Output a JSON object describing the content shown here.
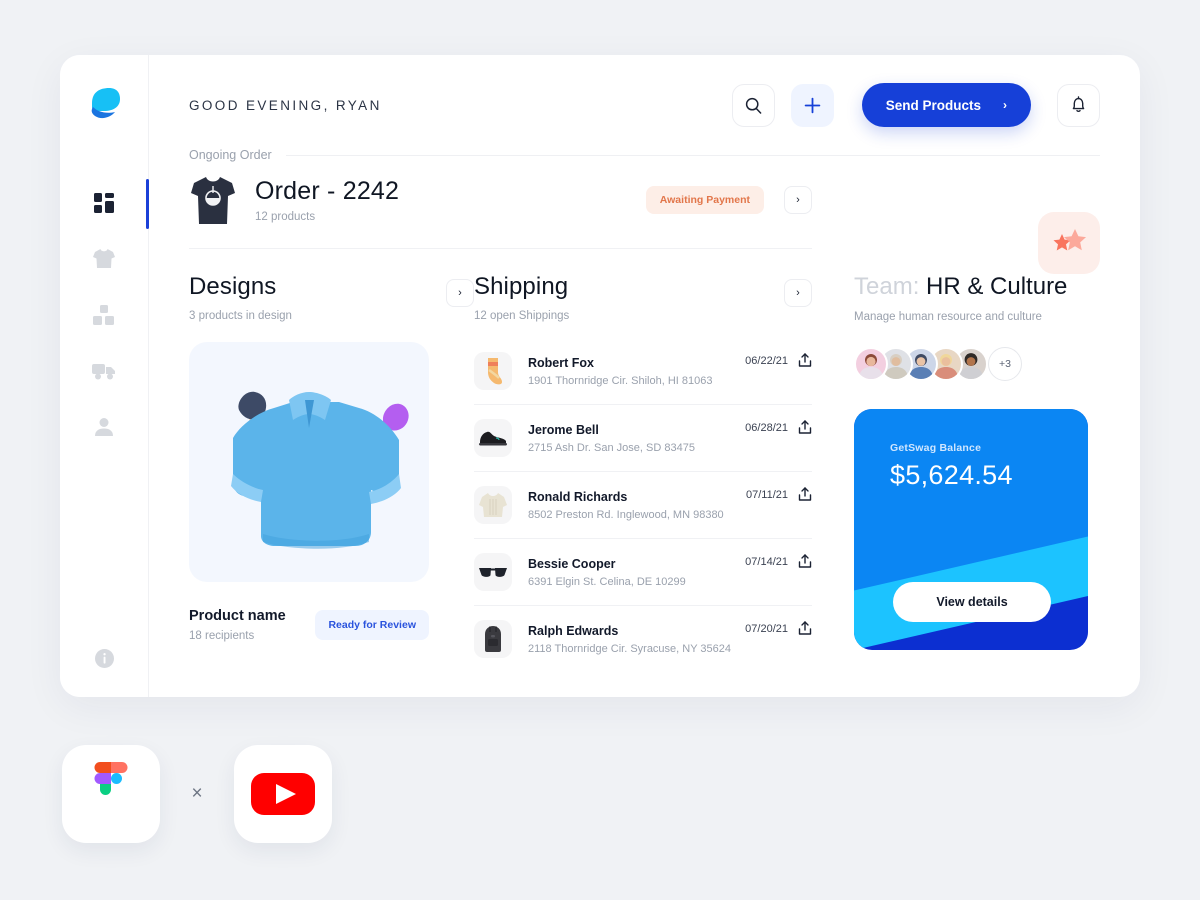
{
  "brand": {
    "logo_icon": "chat-bubble-logo"
  },
  "sidebar": {
    "items": [
      {
        "name": "dashboard",
        "icon": "grid-dashboard-icon",
        "active": true
      },
      {
        "name": "apparel",
        "icon": "tshirt-icon",
        "active": false
      },
      {
        "name": "products",
        "icon": "boxes-icon",
        "active": false
      },
      {
        "name": "shipping",
        "icon": "truck-icon",
        "active": false
      },
      {
        "name": "account",
        "icon": "person-icon",
        "active": false
      }
    ],
    "footer": {
      "icon": "info-circle-icon"
    }
  },
  "header": {
    "greeting": "GOOD EVENING, RYAN",
    "search_icon": "search-icon",
    "add_icon": "plus-icon",
    "send_products_label": "Send Products",
    "send_products_chevron": "›",
    "bell_icon": "bell-icon"
  },
  "ongoing": {
    "section_label": "Ongoing Order",
    "thumb_icon": "black-tshirt-thumbnail",
    "title": "Order - 2242",
    "subtitle": "12 products",
    "status_badge": "Awaiting Payment",
    "chevron": "›",
    "star_tile_icon": "stars-icon"
  },
  "designs": {
    "title": "Designs",
    "subtitle": "3 products in design",
    "chevron": "›",
    "image_icon": "blue-polo-shirt-3d-illustration",
    "product_name": "Product name",
    "product_sub": "18 recipients",
    "status_badge": "Ready for Review"
  },
  "shipping": {
    "title": "Shipping",
    "subtitle": "12 open Shippings",
    "chevron": "›",
    "rows": [
      {
        "thumb": "sock-thumbnail",
        "name": "Robert Fox",
        "address": "1901 Thornridge Cir. Shiloh, HI 81063",
        "date": "06/22/21",
        "action_icon": "share-upload-icon"
      },
      {
        "thumb": "sneaker-thumbnail",
        "name": "Jerome Bell",
        "address": "2715 Ash Dr. San Jose, SD 83475",
        "date": "06/28/21",
        "action_icon": "share-upload-icon"
      },
      {
        "thumb": "sweater-thumbnail",
        "name": "Ronald Richards",
        "address": "8502 Preston Rd. Inglewood, MN 98380",
        "date": "07/11/21",
        "action_icon": "share-upload-icon"
      },
      {
        "thumb": "sunglasses-thumbnail",
        "name": "Bessie Cooper",
        "address": "6391 Elgin St. Celina, DE 10299",
        "date": "07/14/21",
        "action_icon": "share-upload-icon"
      },
      {
        "thumb": "backpack-thumbnail",
        "name": "Ralph Edwards",
        "address": "2118 Thornridge Cir. Syracuse, NY 35624",
        "date": "07/20/21",
        "action_icon": "share-upload-icon"
      }
    ]
  },
  "team": {
    "title_prefix": "Team:",
    "title_name": "HR & Culture",
    "subtitle": "Manage human resource and culture",
    "avatars": [
      {
        "name": "member-1",
        "color": "#f3cfe0"
      },
      {
        "name": "member-2",
        "color": "#dfe1e6"
      },
      {
        "name": "member-3",
        "color": "#cdd6e8"
      },
      {
        "name": "member-4",
        "color": "#e8d7c4"
      },
      {
        "name": "member-5",
        "color": "#d9d2cd"
      }
    ],
    "more_count": "+3"
  },
  "balance": {
    "label": "GetSwag Balance",
    "amount": "$5,624.54",
    "button_label": "View details",
    "colors": {
      "base": "#0c2fd1",
      "band1": "#0b86f3",
      "band2": "#1cc3ff"
    }
  },
  "footer_logos": {
    "figma": "figma-logo",
    "separator": "×",
    "youtube": "youtube-logo"
  }
}
